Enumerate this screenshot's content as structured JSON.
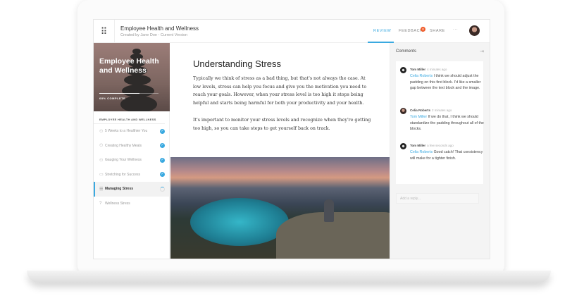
{
  "header": {
    "title": "Employee Health and Wellness",
    "subtitle": "Created by Jane Doe - Current Version",
    "tabs": [
      "REVIEW",
      "FEEDBACK",
      "SHARE"
    ],
    "feedback_badge": "8",
    "more": "···"
  },
  "sidebar": {
    "hero_title": "Employee Health and Wellness",
    "progress_label": "68% COMPLETE",
    "progress": 0.68,
    "section": "EMPLOYEE HEALTH AND WELLNESS",
    "items": [
      {
        "label": "5 Weeks to a Healthier You",
        "icon": "person-icon",
        "done": true
      },
      {
        "label": "Creating Healthy Meals",
        "icon": "person-icon",
        "done": true
      },
      {
        "label": "Gauging Your Wellness",
        "icon": "person-icon",
        "done": true
      },
      {
        "label": "Stretching for Success",
        "icon": "video-icon",
        "done": true
      },
      {
        "label": "Managing Stress",
        "icon": "text-icon",
        "done": false
      },
      {
        "label": "Wellness Stress",
        "icon": "quiz-icon",
        "done": false
      }
    ]
  },
  "main": {
    "title": "Understanding Stress",
    "p1": "Typically we think of stress as a bad thing, but that's not always the case. At low levels, stress can help you focus and give you the motivation you need to reach your goals. However, when your stress level is too high it stops being helpful and starts being harmful for both your productivity and your health.",
    "p2": "It's important to monitor your stress levels and recognize when they're getting too high, so you can take steps to get yourself back on track."
  },
  "comments": {
    "title": "Comments",
    "reply_placeholder": "Add a reply...",
    "items": [
      {
        "author": "Tom Miller",
        "time": "4 minutes ago",
        "mention": "Celia Roberts",
        "text": " I think we should adjust the padding on this first block. I'd like a smaller gap between the text block and the image."
      },
      {
        "author": "Celia Roberts",
        "time": "2 minutes ago",
        "mention": "Tom Miller",
        "text": " If we do that, I think we should standardize the padding throughout all of the blocks."
      },
      {
        "author": "Tom Miller",
        "time": "a few seconds ago",
        "mention": "Celia Roberts",
        "text": " Good catch! That consistency will make for a tighter finish."
      }
    ]
  },
  "colors": {
    "accent": "#3aa9e0",
    "badge": "#f05a28"
  }
}
